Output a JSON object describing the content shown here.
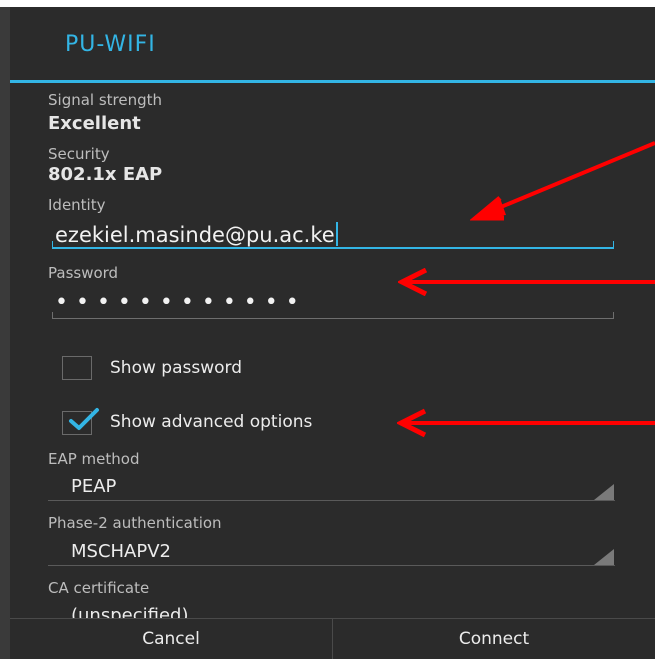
{
  "dialog": {
    "title": "PU-WIFI"
  },
  "signal": {
    "label": "Signal strength",
    "value": "Excellent"
  },
  "security": {
    "label": "Security",
    "value": "802.1x EAP"
  },
  "identity": {
    "label": "Identity",
    "value": "ezekiel.masinde@pu.ac.ke"
  },
  "password": {
    "label": "Password",
    "masked_value": "••••••••••••"
  },
  "show_password": {
    "label": "Show password",
    "checked": false
  },
  "show_advanced": {
    "label": "Show advanced options",
    "checked": true
  },
  "eap_method": {
    "label": "EAP method",
    "value": "PEAP"
  },
  "phase2": {
    "label": "Phase-2 authentication",
    "value": "MSCHAPV2"
  },
  "ca_cert": {
    "label": "CA certificate",
    "value": "(unspecified)"
  },
  "buttons": {
    "cancel": "Cancel",
    "connect": "Connect"
  },
  "colors": {
    "accent": "#33b5e5",
    "annotation_arrow": "#ff0000",
    "dialog_bg": "#2b2b2b"
  },
  "icons": {
    "checkbox_checked": "check-icon",
    "spinner": "dropdown-triangle-icon",
    "annotation": "red-arrow-icon"
  }
}
